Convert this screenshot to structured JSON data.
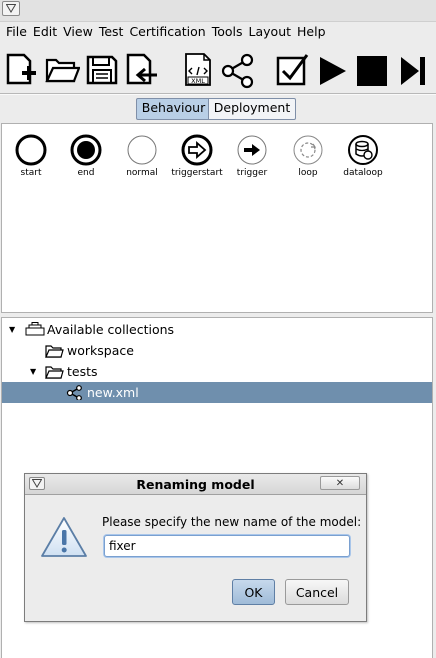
{
  "window": {
    "menu_icon": "triangle-down-icon"
  },
  "menu": [
    "File",
    "Edit",
    "View",
    "Test",
    "Certification",
    "Tools",
    "Layout",
    "Help"
  ],
  "toolbar": {
    "buttons": [
      {
        "name": "new-model",
        "icon": "new-file-icon"
      },
      {
        "name": "open",
        "icon": "folder-open-icon"
      },
      {
        "name": "save",
        "icon": "floppy-disk-icon"
      },
      {
        "name": "import",
        "icon": "import-file-icon"
      },
      {
        "name": "xml",
        "icon": "xml-file-icon",
        "label": "XML"
      },
      {
        "name": "share",
        "icon": "graph-share-icon"
      },
      {
        "name": "verify",
        "icon": "checkbox-check-icon"
      },
      {
        "name": "run",
        "icon": "play-icon"
      },
      {
        "name": "stop",
        "icon": "stop-icon"
      },
      {
        "name": "step",
        "icon": "step-forward-icon"
      }
    ]
  },
  "tabs": {
    "behaviour": "Behaviour",
    "deployment": "Deployment",
    "active": "Behaviour"
  },
  "palette": {
    "items": [
      {
        "label": "start",
        "icon": "start-circle-icon"
      },
      {
        "label": "end",
        "icon": "end-circle-icon"
      },
      {
        "label": "normal",
        "icon": "normal-circle-icon"
      },
      {
        "label": "triggerstart",
        "icon": "trigger-start-icon"
      },
      {
        "label": "trigger",
        "icon": "trigger-arrow-icon"
      },
      {
        "label": "loop",
        "icon": "loop-icon"
      },
      {
        "label": "dataloop",
        "icon": "database-loop-icon"
      }
    ]
  },
  "tree": {
    "root": "Available collections",
    "workspace": "workspace",
    "tests": "tests",
    "new_xml": "new.xml",
    "selected": "new.xml"
  },
  "dialog": {
    "title": "Renaming model",
    "message": "Please specify the new name of the model:",
    "input_value": "fixer",
    "ok": "OK",
    "cancel": "Cancel",
    "icon": "warning-triangle-icon"
  }
}
